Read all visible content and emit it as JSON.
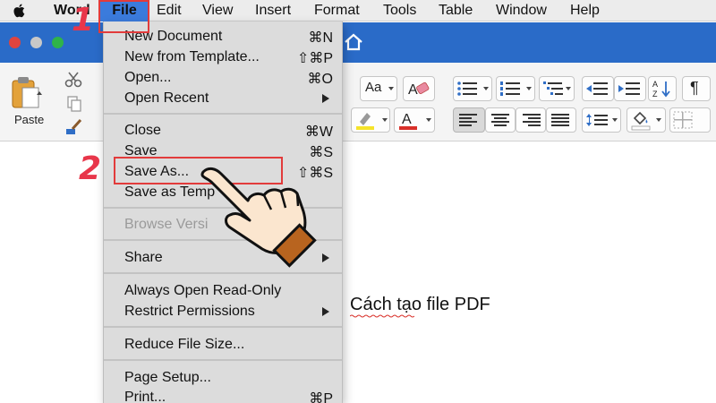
{
  "menubar": {
    "app_name": "Word",
    "items": [
      "File",
      "Edit",
      "View",
      "Insert",
      "Format",
      "Tools",
      "Table",
      "Window",
      "Help"
    ]
  },
  "ribbon": {
    "paste_label": "Paste"
  },
  "file_menu": {
    "items": [
      {
        "label": "New Document",
        "shortcut": "⌘N"
      },
      {
        "label": "New from Template...",
        "shortcut": "⇧⌘P"
      },
      {
        "label": "Open...",
        "shortcut": "⌘O"
      },
      {
        "label": "Open Recent",
        "submenu": true
      },
      {
        "label": "Close",
        "shortcut": "⌘W"
      },
      {
        "label": "Save",
        "shortcut": "⌘S"
      },
      {
        "label": "Save As...",
        "shortcut": "⇧⌘S"
      },
      {
        "label": "Save as Temp"
      },
      {
        "label": "Browse Versi",
        "disabled": true
      },
      {
        "label": "Share",
        "submenu": true
      },
      {
        "label": "Always Open Read-Only"
      },
      {
        "label": "Restrict Permissions",
        "submenu": true
      },
      {
        "label": "Reduce File Size..."
      },
      {
        "label": "Page Setup..."
      },
      {
        "label": "Print...",
        "shortcut": "⌘P"
      }
    ]
  },
  "document": {
    "text": "Cách tạo file PDF"
  },
  "annotations": {
    "step1": "1",
    "step2": "2",
    "highlight_color": "#e23b3b"
  },
  "colors": {
    "file_menu_highlight": "#3b7bdc",
    "title_strip": "#2a6bc8",
    "step_number": "#e8364a"
  }
}
